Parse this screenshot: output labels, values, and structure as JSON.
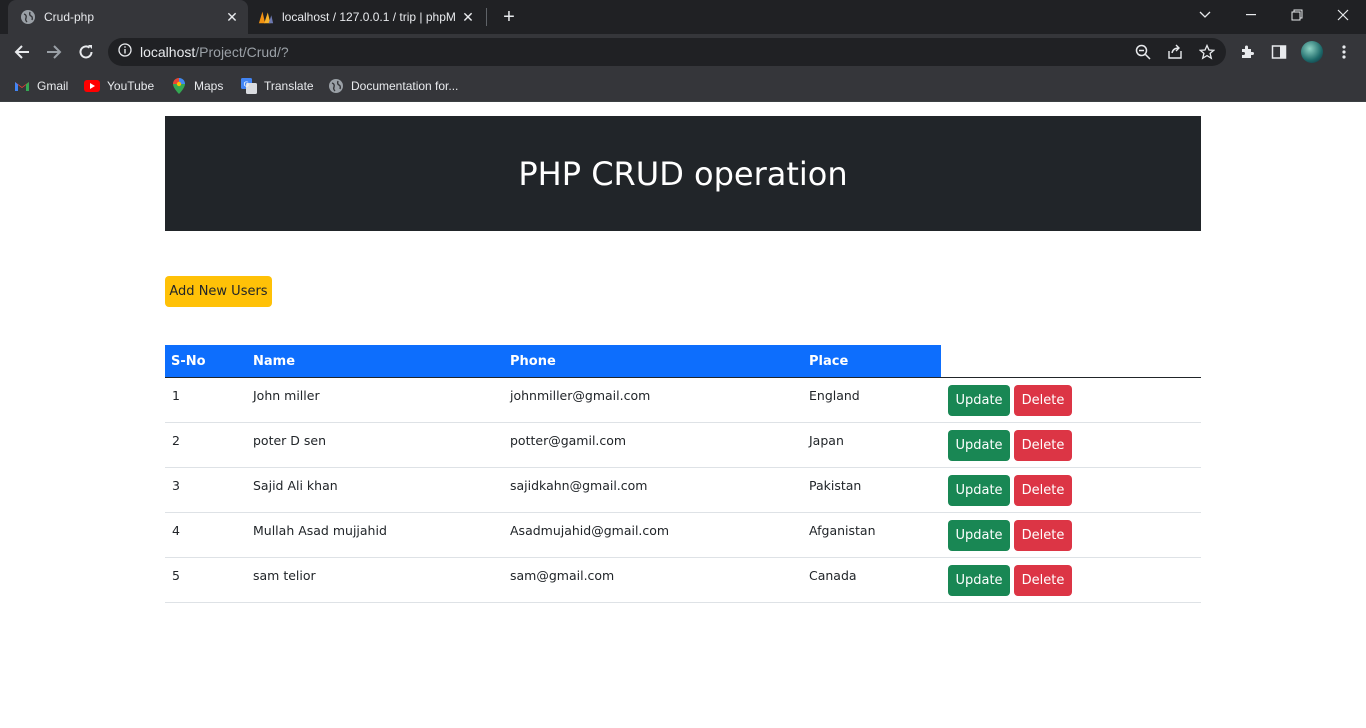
{
  "browser": {
    "tabs": [
      {
        "title": "Crud-php",
        "active": true,
        "icon": "globe-icon"
      },
      {
        "title": "localhost / 127.0.0.1 / trip | phpM",
        "active": false,
        "icon": "phpmyadmin-icon"
      }
    ],
    "address": {
      "host": "localhost",
      "path": "/Project/Crud/?"
    },
    "bookmarks": [
      {
        "label": "Gmail",
        "icon": "gmail-icon"
      },
      {
        "label": "YouTube",
        "icon": "youtube-icon"
      },
      {
        "label": "Maps",
        "icon": "maps-icon"
      },
      {
        "label": "Translate",
        "icon": "translate-icon"
      },
      {
        "label": "Documentation for...",
        "icon": "globe-icon"
      }
    ]
  },
  "page": {
    "title": "PHP CRUD operation",
    "add_button": "Add New Users",
    "table": {
      "headers": [
        "S-No",
        "Name",
        "Phone",
        "Place"
      ],
      "rows": [
        {
          "sno": "1",
          "name": "John miller",
          "phone": "johnmiller@gmail.com",
          "place": "England"
        },
        {
          "sno": "2",
          "name": "poter D sen",
          "phone": "potter@gamil.com",
          "place": "Japan"
        },
        {
          "sno": "3",
          "name": "Sajid Ali khan",
          "phone": "sajidkahn@gmail.com",
          "place": "Pakistan"
        },
        {
          "sno": "4",
          "name": "Mullah Asad mujjahid",
          "phone": "Asadmujahid@gmail.com",
          "place": "Afganistan"
        },
        {
          "sno": "5",
          "name": "sam telior",
          "phone": "sam@gmail.com",
          "place": "Canada"
        }
      ],
      "update_label": "Update",
      "delete_label": "Delete"
    }
  },
  "colors": {
    "header_bg": "#212529",
    "add_button": "#ffc107",
    "table_header": "#0d6efd",
    "update": "#198754",
    "delete": "#dc3545"
  }
}
